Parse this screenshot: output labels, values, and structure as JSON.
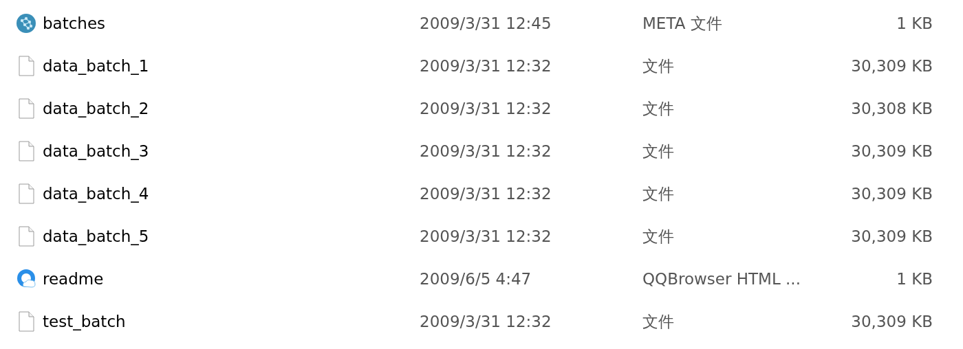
{
  "files": [
    {
      "name": "batches",
      "kind": "meta",
      "modified": "2009/3/31 12:45",
      "type": "META 文件",
      "size": "1 KB"
    },
    {
      "name": "data_batch_1",
      "kind": "file",
      "modified": "2009/3/31 12:32",
      "type": "文件",
      "size": "30,309 KB"
    },
    {
      "name": "data_batch_2",
      "kind": "file",
      "modified": "2009/3/31 12:32",
      "type": "文件",
      "size": "30,308 KB"
    },
    {
      "name": "data_batch_3",
      "kind": "file",
      "modified": "2009/3/31 12:32",
      "type": "文件",
      "size": "30,309 KB"
    },
    {
      "name": "data_batch_4",
      "kind": "file",
      "modified": "2009/3/31 12:32",
      "type": "文件",
      "size": "30,309 KB"
    },
    {
      "name": "data_batch_5",
      "kind": "file",
      "modified": "2009/3/31 12:32",
      "type": "文件",
      "size": "30,309 KB"
    },
    {
      "name": "readme",
      "kind": "browser",
      "modified": "2009/6/5 4:47",
      "type": "QQBrowser HTML ...",
      "size": "1 KB"
    },
    {
      "name": "test_batch",
      "kind": "file",
      "modified": "2009/3/31 12:32",
      "type": "文件",
      "size": "30,309 KB"
    }
  ]
}
